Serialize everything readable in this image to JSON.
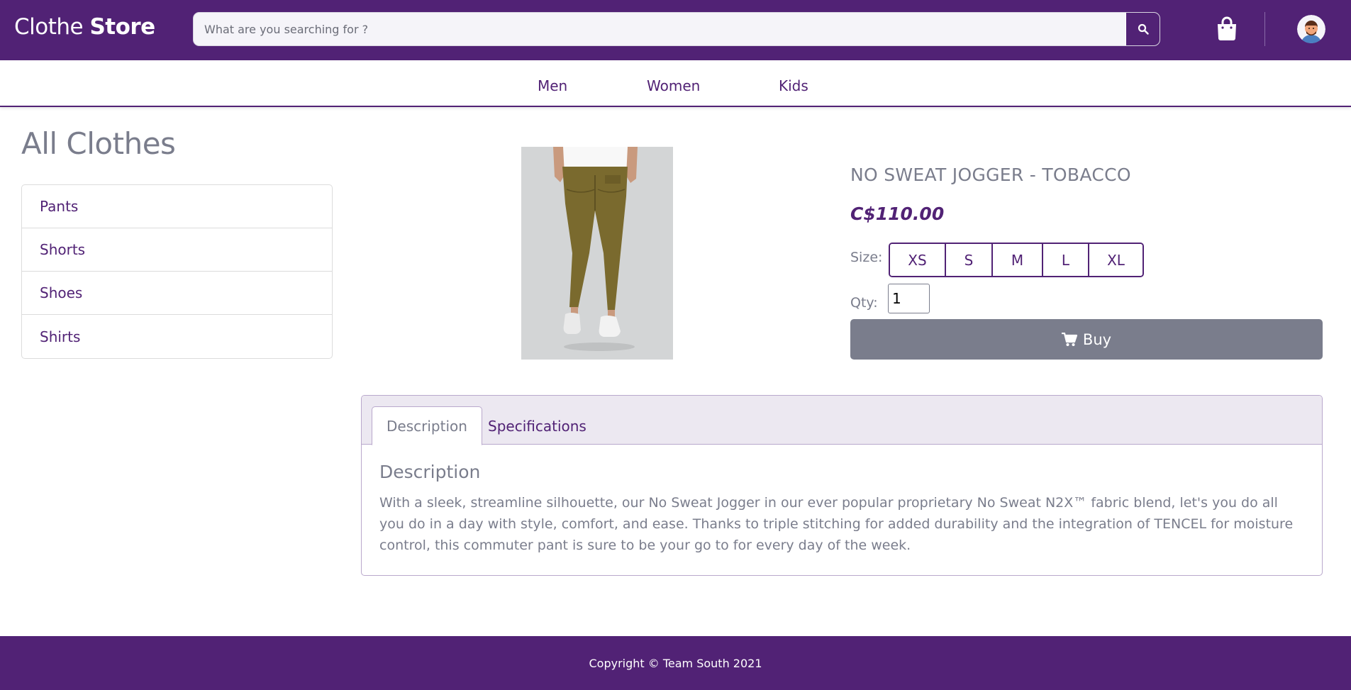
{
  "header": {
    "brand_light": "Clothe ",
    "brand_bold": "Store",
    "search_placeholder": "What are you searching for ?",
    "search_icon": "search-icon",
    "cart_icon": "shopping-bag-icon",
    "avatar_icon": "user-avatar-icon"
  },
  "nav": {
    "items": [
      {
        "label": "Men"
      },
      {
        "label": "Women"
      },
      {
        "label": "Kids"
      }
    ]
  },
  "sidebar": {
    "title": "All Clothes",
    "categories": [
      {
        "label": "Pants"
      },
      {
        "label": "Shorts"
      },
      {
        "label": "Shoes"
      },
      {
        "label": "Shirts"
      }
    ]
  },
  "product": {
    "title": "NO SWEAT JOGGER - TOBACCO",
    "price": "C$110.00",
    "size_label": "Size:",
    "sizes": [
      "XS",
      "S",
      "M",
      "L",
      "XL"
    ],
    "qty_label": "Qty:",
    "qty_value": "1",
    "buy_label": "Buy",
    "buy_icon": "shopping-cart-icon"
  },
  "tabs": {
    "items": [
      {
        "label": "Description",
        "active": true
      },
      {
        "label": "Specifications",
        "active": false
      }
    ],
    "heading": "Description",
    "text": "With a sleek, streamline silhouette, our No Sweat Jogger in our ever popular proprietary No Sweat N2X™ fabric blend, let's you do all you do in a day with style, comfort, and ease. Thanks to triple stitching for added durability and the integration of TENCEL for moisture control, this commuter pant is sure to be your go to for every day of the week."
  },
  "footer": {
    "copyright": "Copyright © Team South 2021"
  },
  "colors": {
    "brand": "#512275",
    "muted": "#7a7d8c"
  }
}
